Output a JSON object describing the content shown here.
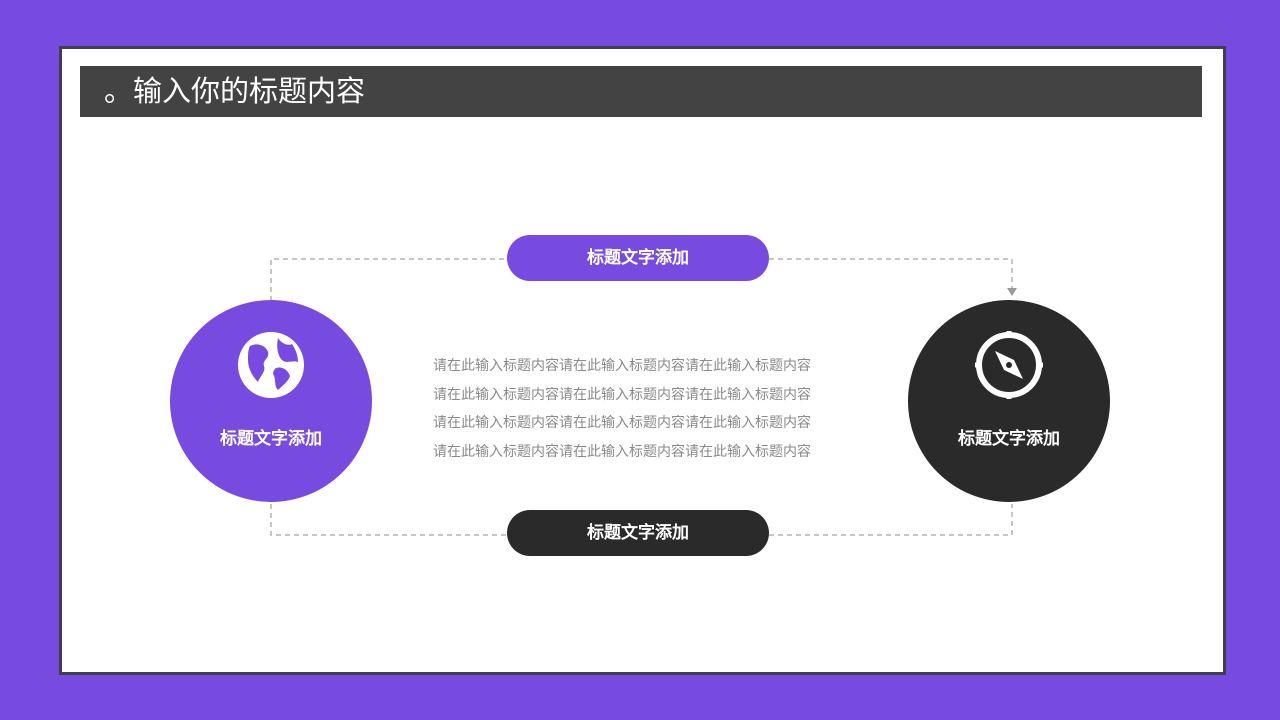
{
  "header": {
    "title": "。输入你的标题内容"
  },
  "top_pill": {
    "label": "标题文字添加"
  },
  "bottom_pill": {
    "label": "标题文字添加"
  },
  "left_circle": {
    "label": "标题文字添加",
    "icon": "globe-icon",
    "color": "#774ae0"
  },
  "right_circle": {
    "label": "标题文字添加",
    "icon": "compass-icon",
    "color": "#2a2a2a"
  },
  "body_text": {
    "lines": [
      "请在此输入标题内容请在此输入标题内容请在此输入标题内容",
      "请在此输入标题内容请在此输入标题内容请在此输入标题内容",
      "请在此输入标题内容请在此输入标题内容请在此输入标题内容",
      "请在此输入标题内容请在此输入标题内容请在此输入标题内容"
    ]
  },
  "colors": {
    "background": "#774ae0",
    "accent": "#774ae0",
    "dark": "#2a2a2a",
    "title_bar": "#434343",
    "connector": "#b4b4b4"
  }
}
